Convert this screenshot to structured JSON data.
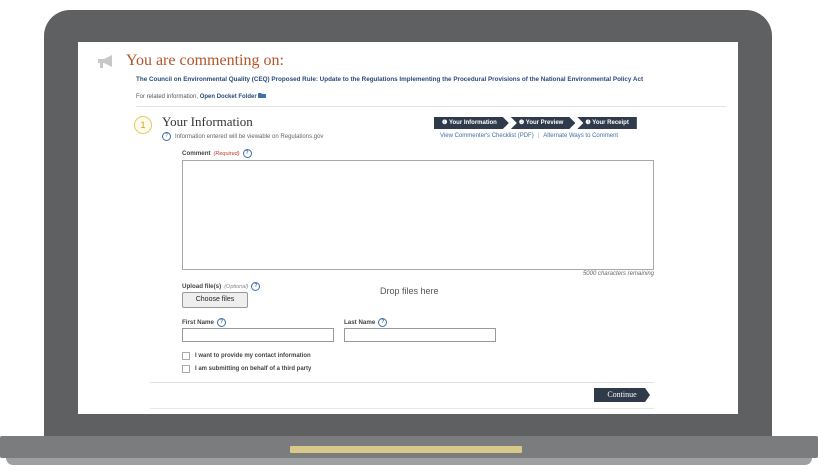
{
  "header": {
    "title": "You are commenting on:",
    "icon": "megaphone-icon"
  },
  "document": {
    "title": "The Council on Environmental Quality (CEQ) Proposed Rule: Update to the Regulations Implementing the Procedural Provisions of the National Environmental Policy Act",
    "related_prefix": "For related information,",
    "related_link": "Open Docket Folder"
  },
  "section": {
    "step_number": "1",
    "title": "Your Information",
    "note": "Information entered will be viewable on Regulations.gov"
  },
  "steps": [
    "Your Information",
    "Your Preview",
    "Your Receipt"
  ],
  "links": {
    "checklist": "View Commenter's Checklist (PDF)",
    "alternate": "Alternate Ways to Comment"
  },
  "comment": {
    "label": "Comment",
    "required": "(Required)",
    "chars_remaining": "5000 characters remaining"
  },
  "upload": {
    "label": "Upload file(s)",
    "optional": "(Optional)",
    "button": "Choose files",
    "drop": "Drop files here"
  },
  "first_name": {
    "label": "First Name"
  },
  "last_name": {
    "label": "Last Name"
  },
  "checkboxes": [
    "I want to provide my contact information",
    "I am submitting on behalf of a third party"
  ],
  "continue_label": "Continue",
  "colors": {
    "accent": "#b2542b",
    "nav_dark": "#2f3a4a",
    "link": "#2b4a7a",
    "bezel": "#5f6062"
  }
}
